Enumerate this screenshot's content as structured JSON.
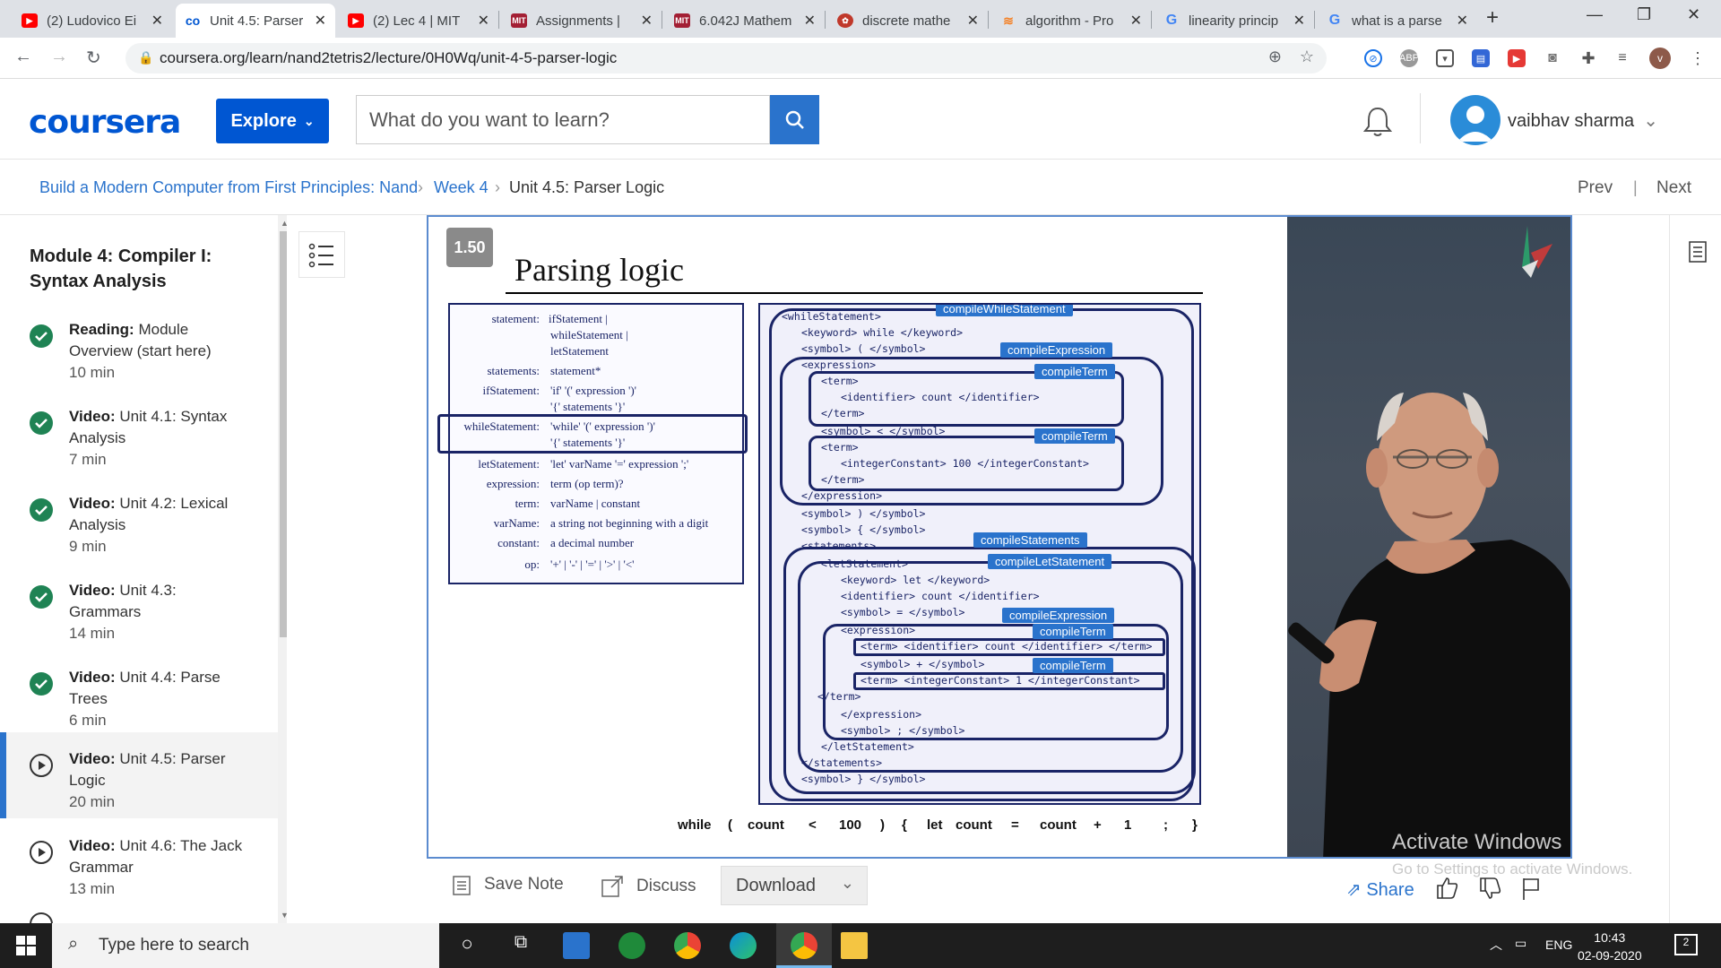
{
  "browser": {
    "tabs": [
      {
        "title": "(2) Ludovico Ei",
        "favicon": "youtube-icon",
        "color": "#ff0000"
      },
      {
        "title": "Unit 4.5: Parser",
        "favicon": "coursera-icon",
        "color": "#0056d2",
        "active": true
      },
      {
        "title": "(2) Lec 4 | MIT",
        "favicon": "youtube-icon",
        "color": "#ff0000"
      },
      {
        "title": "Assignments |",
        "favicon": "mit-icon",
        "color": "#a31f34"
      },
      {
        "title": "6.042J Mathem",
        "favicon": "mit-icon",
        "color": "#a31f34"
      },
      {
        "title": "discrete mathe",
        "favicon": "gear-icon",
        "color": "#c0392b"
      },
      {
        "title": "algorithm - Pro",
        "favicon": "stackoverflow-icon",
        "color": "#f48024"
      },
      {
        "title": "linearity princip",
        "favicon": "google-icon",
        "color": "#4285f4"
      },
      {
        "title": "what is a parse",
        "favicon": "google-icon",
        "color": "#4285f4"
      }
    ],
    "new_tab": "+",
    "url": "coursera.org/learn/nand2tetris2/lecture/0H0Wq/unit-4-5-parser-logic",
    "profile_initial": "v"
  },
  "header": {
    "logo": "coursera",
    "explore": "Explore",
    "search_placeholder": "What do you want to learn?",
    "user_name": "vaibhav sharma"
  },
  "breadcrumb": {
    "course": "Build a Modern Computer from First Principles: Nand",
    "week": "Week 4",
    "current": "Unit 4.5: Parser Logic",
    "prev": "Prev",
    "next": "Next"
  },
  "sidebar": {
    "module_title": "Module 4: Compiler I: Syntax Analysis",
    "items": [
      {
        "type": "Reading:",
        "title": "Module Overview (start here)",
        "duration": "10 min",
        "status": "done"
      },
      {
        "type": "Video:",
        "title": "Unit 4.1: Syntax Analysis",
        "duration": "7 min",
        "status": "done"
      },
      {
        "type": "Video:",
        "title": "Unit 4.2: Lexical Analysis",
        "duration": "9 min",
        "status": "done"
      },
      {
        "type": "Video:",
        "title": "Unit 4.3: Grammars",
        "duration": "14 min",
        "status": "done"
      },
      {
        "type": "Video:",
        "title": "Unit 4.4: Parse Trees",
        "duration": "6 min",
        "status": "done"
      },
      {
        "type": "Video:",
        "title": "Unit 4.5: Parser Logic",
        "duration": "20 min",
        "status": "current"
      },
      {
        "type": "Video:",
        "title": "Unit 4.6: The Jack Grammar",
        "duration": "13 min",
        "status": "todo"
      }
    ]
  },
  "slide": {
    "number": "1.50",
    "title": "Parsing logic",
    "grammar": [
      {
        "name": "statement:",
        "def": [
          "ifStatement |",
          "whileStatement |",
          "letStatement"
        ]
      },
      {
        "name": "statements:",
        "def": [
          "statement*"
        ]
      },
      {
        "name": "ifStatement:",
        "def": [
          "'if' '(' expression ')'",
          "'{' statements '}'"
        ]
      },
      {
        "name": "whileStatement:",
        "def": [
          "'while' '(' expression ')'",
          "'{' statements '}'"
        ]
      },
      {
        "name": "letStatement:",
        "def": [
          "'let' varName '=' expression ';'"
        ]
      },
      {
        "name": "expression:",
        "def": [
          "term (op term)?"
        ]
      },
      {
        "name": "term:",
        "def": [
          "varName | constant"
        ]
      },
      {
        "name": "varName:",
        "def": [
          "a string not beginning with a digit"
        ]
      },
      {
        "name": "constant:",
        "def": [
          "a decimal number"
        ]
      },
      {
        "name": "op:",
        "def": [
          "'+' | '-' | '=' | '>' | '<'"
        ]
      }
    ],
    "xml": [
      "<whileStatement>",
      "<keyword> while </keyword>",
      "<symbol> ( </symbol>",
      "<expression>",
      "<term>",
      "<identifier> count </identifier>",
      "</term>",
      "<symbol> < </symbol>",
      "<term>",
      "<integerConstant> 100 </integerConstant>",
      "</term>",
      "</expression>",
      "<symbol> ) </symbol>",
      "<symbol> { </symbol>",
      "<statements>",
      "<letStatement>",
      "<keyword> let </keyword>",
      "<identifier> count </identifier>",
      "<symbol> = </symbol>",
      "<expression>",
      "<term> <identifier> count </identifier> </term>",
      "<symbol> + </symbol>",
      "<term> <integerConstant> 1 </integerConstant>",
      "</term>",
      "</expression>",
      "<symbol> ; </symbol>",
      "</letStatement>",
      "</statements>",
      "<symbol> } </symbol>"
    ],
    "labels": {
      "while": "compileWhileStatement",
      "expr1": "compileExpression",
      "term1": "compileTerm",
      "term2": "compileTerm",
      "statements": "compileStatements",
      "let": "compileLetStatement",
      "expr2": "compileExpression",
      "term3": "compileTerm",
      "term4": "compileTerm"
    },
    "tokens": [
      "while",
      "(",
      "count",
      "<",
      "100",
      ")",
      "{",
      "let",
      "count",
      "=",
      "count",
      "+",
      "1",
      ";",
      "}"
    ]
  },
  "watermark": {
    "line1": "Activate Windows",
    "line2": "Go to Settings to activate Windows."
  },
  "controls": {
    "save_note": "Save Note",
    "discuss": "Discuss",
    "download": "Download",
    "share": "Share"
  },
  "taskbar": {
    "search": "Type here to search",
    "lang": "ENG",
    "time": "10:43",
    "date": "02-09-2020",
    "notifications": "2"
  }
}
